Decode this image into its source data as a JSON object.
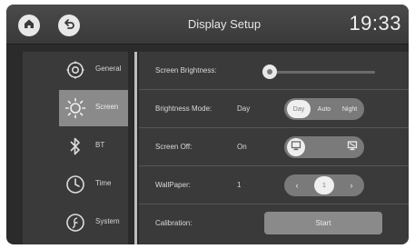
{
  "header": {
    "title": "Display Setup",
    "clock": "19:33",
    "home_icon": "home-icon",
    "back_icon": "back-icon"
  },
  "sidebar": {
    "items": [
      {
        "label": "General",
        "icon": "gear-icon",
        "active": false
      },
      {
        "label": "Screen",
        "icon": "sun-icon",
        "active": true
      },
      {
        "label": "BT",
        "icon": "bluetooth-icon",
        "active": false
      },
      {
        "label": "Time",
        "icon": "clock-icon",
        "active": false
      },
      {
        "label": "System",
        "icon": "info-icon",
        "active": false
      }
    ]
  },
  "settings": {
    "brightness": {
      "label": "Screen Brightness:",
      "value_fraction": 0.05
    },
    "brightness_mode": {
      "label": "Brightness Mode:",
      "value": "Day",
      "options": [
        "Day",
        "Auto",
        "Night"
      ],
      "selected": "Day"
    },
    "screen_off": {
      "label": "Screen Off:",
      "value": "On",
      "options": [
        "monitor-icon",
        "monitor-off-icon"
      ],
      "selected": "monitor-icon"
    },
    "wallpaper": {
      "label": "WallPaper:",
      "value": "1",
      "options": [
        "‹",
        "1",
        "›"
      ],
      "selected": "1"
    },
    "calibration": {
      "label": "Calibration:",
      "button_label": "Start"
    }
  },
  "colors": {
    "background": "#2b2b2b",
    "panel": "#3a3a3a",
    "active_item": "#8a8a8a",
    "pill": "#7a7a7a",
    "selected": "#efefef"
  }
}
